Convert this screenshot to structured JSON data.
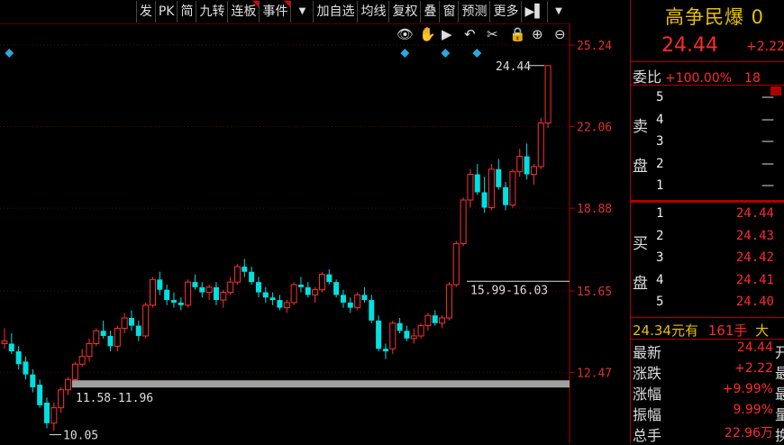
{
  "toolbar": {
    "buttons": [
      "发",
      "PK",
      "简",
      "九转",
      "连板",
      "事件",
      "加自选",
      "均线",
      "复权",
      "叠",
      "窗",
      "预测",
      "更多",
      "▶▌"
    ]
  },
  "chart_tools": [
    "eye-icon",
    "hand-icon",
    "play-icon",
    "undo-icon",
    "scissors-icon",
    "lock-icon",
    "zoom-in-icon",
    "zoom-out-icon"
  ],
  "colors": {
    "up": "#ff3030",
    "down": "#00e0e0",
    "accent": "#e8c000",
    "marker": "#2aa8e0"
  },
  "chart_data": {
    "type": "candlestick",
    "y_ticks": [
      "25.24",
      "22.06",
      "18.88",
      "15.65",
      "12.47"
    ],
    "ylim": [
      10.0,
      25.24
    ],
    "annotations": {
      "high_label": "24.44",
      "zone_upper": "15.99-16.03",
      "zone_lower": "11.58-11.96",
      "low_label": "10.05"
    },
    "candles": [
      [
        13.6,
        14.2,
        13.4,
        13.7
      ],
      [
        13.6,
        14.0,
        13.2,
        13.3
      ],
      [
        13.3,
        13.5,
        12.6,
        12.8
      ],
      [
        12.9,
        13.1,
        12.2,
        12.4
      ],
      [
        12.4,
        12.6,
        11.7,
        11.9
      ],
      [
        12.0,
        12.2,
        11.1,
        11.2
      ],
      [
        11.3,
        11.5,
        10.3,
        10.5
      ],
      [
        10.5,
        11.3,
        10.2,
        11.1
      ],
      [
        11.1,
        11.9,
        10.9,
        11.8
      ],
      [
        11.8,
        12.3,
        11.6,
        12.2
      ],
      [
        12.2,
        12.9,
        12.0,
        12.8
      ],
      [
        12.8,
        13.4,
        12.7,
        13.1
      ],
      [
        13.1,
        13.8,
        12.9,
        13.6
      ],
      [
        13.6,
        14.2,
        13.5,
        14.1
      ],
      [
        14.1,
        14.5,
        13.8,
        13.9
      ],
      [
        13.9,
        14.1,
        13.3,
        13.5
      ],
      [
        13.5,
        14.3,
        13.3,
        14.2
      ],
      [
        14.2,
        14.8,
        14.0,
        14.6
      ],
      [
        14.6,
        14.9,
        14.1,
        14.3
      ],
      [
        14.3,
        14.5,
        13.7,
        13.9
      ],
      [
        13.9,
        15.2,
        13.8,
        15.1
      ],
      [
        15.1,
        16.2,
        15.0,
        16.1
      ],
      [
        16.1,
        16.4,
        15.5,
        15.7
      ],
      [
        15.7,
        15.9,
        15.1,
        15.3
      ],
      [
        15.3,
        15.6,
        15.0,
        15.2
      ],
      [
        15.2,
        15.4,
        14.9,
        15.1
      ],
      [
        15.1,
        16.1,
        15.0,
        16.0
      ],
      [
        16.0,
        16.3,
        15.7,
        15.8
      ],
      [
        15.8,
        16.0,
        15.4,
        15.6
      ],
      [
        15.6,
        15.9,
        15.3,
        15.8
      ],
      [
        15.8,
        16.0,
        15.1,
        15.3
      ],
      [
        15.3,
        15.7,
        15.0,
        15.6
      ],
      [
        15.6,
        16.2,
        15.5,
        16.0
      ],
      [
        16.0,
        16.7,
        15.9,
        16.6
      ],
      [
        16.6,
        16.9,
        16.2,
        16.4
      ],
      [
        16.4,
        16.6,
        15.9,
        16.0
      ],
      [
        16.0,
        16.2,
        15.4,
        15.6
      ],
      [
        15.6,
        15.8,
        15.2,
        15.4
      ],
      [
        15.4,
        15.6,
        15.1,
        15.3
      ],
      [
        15.3,
        15.5,
        14.9,
        15.0
      ],
      [
        15.0,
        15.3,
        14.8,
        15.2
      ],
      [
        15.2,
        16.0,
        15.1,
        15.9
      ],
      [
        15.9,
        16.2,
        15.6,
        15.8
      ],
      [
        15.8,
        16.0,
        15.4,
        15.5
      ],
      [
        15.5,
        15.8,
        15.2,
        15.7
      ],
      [
        15.7,
        16.4,
        15.6,
        16.3
      ],
      [
        16.3,
        16.5,
        15.9,
        16.0
      ],
      [
        16.0,
        16.1,
        15.4,
        15.5
      ],
      [
        15.5,
        15.7,
        15.0,
        15.2
      ],
      [
        15.2,
        15.4,
        14.8,
        15.0
      ],
      [
        15.0,
        15.6,
        14.9,
        15.5
      ],
      [
        15.5,
        15.8,
        15.2,
        15.3
      ],
      [
        15.3,
        15.5,
        14.4,
        14.5
      ],
      [
        14.5,
        14.7,
        13.3,
        13.4
      ],
      [
        13.4,
        13.6,
        13.0,
        13.3
      ],
      [
        13.4,
        14.5,
        13.2,
        14.4
      ],
      [
        14.4,
        14.6,
        14.0,
        14.1
      ],
      [
        14.1,
        14.3,
        13.7,
        13.8
      ],
      [
        13.8,
        14.2,
        13.6,
        13.9
      ],
      [
        13.9,
        14.4,
        13.8,
        14.3
      ],
      [
        14.3,
        14.8,
        14.1,
        14.7
      ],
      [
        14.7,
        14.9,
        14.3,
        14.4
      ],
      [
        14.4,
        14.7,
        14.2,
        14.6
      ],
      [
        14.6,
        16.0,
        14.5,
        15.9
      ],
      [
        15.9,
        17.6,
        15.8,
        17.5
      ],
      [
        17.5,
        19.3,
        17.4,
        19.2
      ],
      [
        19.2,
        20.4,
        18.9,
        20.2
      ],
      [
        20.2,
        20.6,
        19.4,
        19.5
      ],
      [
        19.5,
        20.1,
        18.7,
        18.9
      ],
      [
        18.9,
        20.6,
        18.8,
        20.4
      ],
      [
        20.4,
        20.8,
        19.6,
        19.7
      ],
      [
        19.7,
        19.9,
        18.8,
        19.0
      ],
      [
        19.0,
        20.4,
        18.9,
        20.3
      ],
      [
        20.3,
        21.2,
        20.1,
        20.9
      ],
      [
        20.9,
        21.4,
        20.0,
        20.2
      ],
      [
        20.2,
        20.6,
        19.8,
        20.5
      ],
      [
        20.5,
        22.4,
        20.4,
        22.2
      ],
      [
        22.2,
        24.44,
        22.0,
        24.44
      ]
    ]
  },
  "panel": {
    "title": "高争民爆 0",
    "price": "24.44",
    "change": "+2.22",
    "weibi_label": "委比",
    "weibi_value": "+100.00%",
    "weibi_extra": "18",
    "sell_label_1": "卖",
    "sell_label_2": "盘",
    "buy_label_1": "买",
    "buy_label_2": "盘",
    "sell": [
      {
        "n": "5",
        "p": "—"
      },
      {
        "n": "4",
        "p": "—"
      },
      {
        "n": "3",
        "p": "—"
      },
      {
        "n": "2",
        "p": "—"
      },
      {
        "n": "1",
        "p": "—"
      }
    ],
    "buy": [
      {
        "n": "1",
        "p": "24.44"
      },
      {
        "n": "2",
        "p": "24.43"
      },
      {
        "n": "3",
        "p": "24.42"
      },
      {
        "n": "4",
        "p": "24.41"
      },
      {
        "n": "5",
        "p": "24.40"
      }
    ],
    "trade": {
      "price": "24.34",
      "unit1": "元有",
      "qty": "161手",
      "tail": "大"
    },
    "stats": [
      {
        "k": "最新",
        "v": "24.44",
        "s": "开"
      },
      {
        "k": "涨跌",
        "v": "+2.22",
        "s": "最"
      },
      {
        "k": "涨幅",
        "v": "+9.99%",
        "s": "最"
      },
      {
        "k": "振幅",
        "v": "9.99%",
        "s": "量"
      },
      {
        "k": "总手",
        "v": "22.96万",
        "s": "换"
      }
    ]
  }
}
